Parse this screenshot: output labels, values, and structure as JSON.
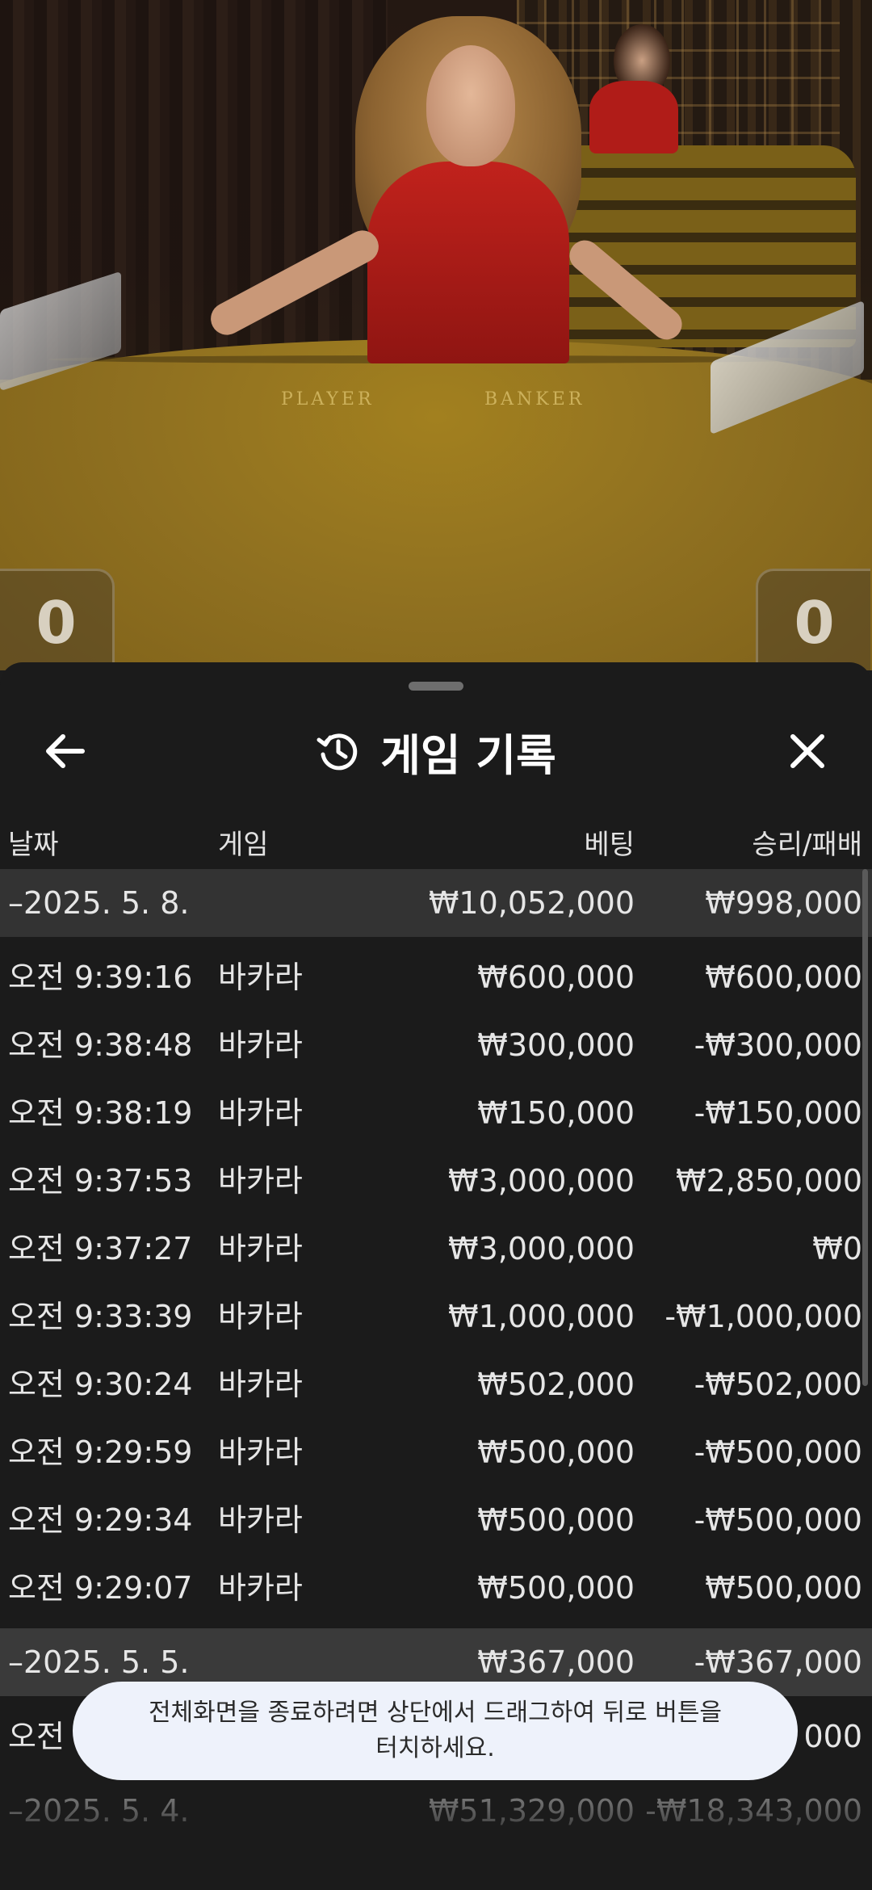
{
  "scores": {
    "player": "0",
    "banker": "0"
  },
  "table_labels": {
    "player": "PLAYER",
    "banker": "BANKER"
  },
  "sheet": {
    "title": "게임 기록",
    "icons": {
      "back": "arrow-left-icon",
      "history": "history-icon",
      "close": "close-icon"
    },
    "columns": {
      "date": "날짜",
      "game": "게임",
      "bet": "베팅",
      "result": "승리/패배"
    },
    "groups": [
      {
        "date": "–2025. 5. 8.",
        "total_bet": "₩10,052,000",
        "total_result": "₩998,000",
        "rows": [
          {
            "time": "오전 9:39:16",
            "game": "바카라",
            "bet": "₩600,000",
            "result": "₩600,000"
          },
          {
            "time": "오전 9:38:48",
            "game": "바카라",
            "bet": "₩300,000",
            "result": "-₩300,000"
          },
          {
            "time": "오전 9:38:19",
            "game": "바카라",
            "bet": "₩150,000",
            "result": "-₩150,000"
          },
          {
            "time": "오전 9:37:53",
            "game": "바카라",
            "bet": "₩3,000,000",
            "result": "₩2,850,000"
          },
          {
            "time": "오전 9:37:27",
            "game": "바카라",
            "bet": "₩3,000,000",
            "result": "₩0"
          },
          {
            "time": "오전 9:33:39",
            "game": "바카라",
            "bet": "₩1,000,000",
            "result": "-₩1,000,000"
          },
          {
            "time": "오전 9:30:24",
            "game": "바카라",
            "bet": "₩502,000",
            "result": "-₩502,000"
          },
          {
            "time": "오전 9:29:59",
            "game": "바카라",
            "bet": "₩500,000",
            "result": "-₩500,000"
          },
          {
            "time": "오전 9:29:34",
            "game": "바카라",
            "bet": "₩500,000",
            "result": "-₩500,000"
          },
          {
            "time": "오전 9:29:07",
            "game": "바카라",
            "bet": "₩500,000",
            "result": "₩500,000"
          }
        ]
      },
      {
        "date": "–2025. 5. 5.",
        "total_bet": "₩367,000",
        "total_result": "-₩367,000",
        "rows": [
          {
            "time": "오전",
            "game": "",
            "bet": "",
            "result": "000"
          }
        ]
      },
      {
        "date": "–2025. 5. 4.",
        "total_bet": "₩51,329,000",
        "total_result": "-₩18,343,000",
        "rows": []
      }
    ]
  },
  "toast": {
    "line1": "전체화면을 종료하려면 상단에서 드래그하여 뒤로 버튼을",
    "line2": "터치하세요."
  }
}
